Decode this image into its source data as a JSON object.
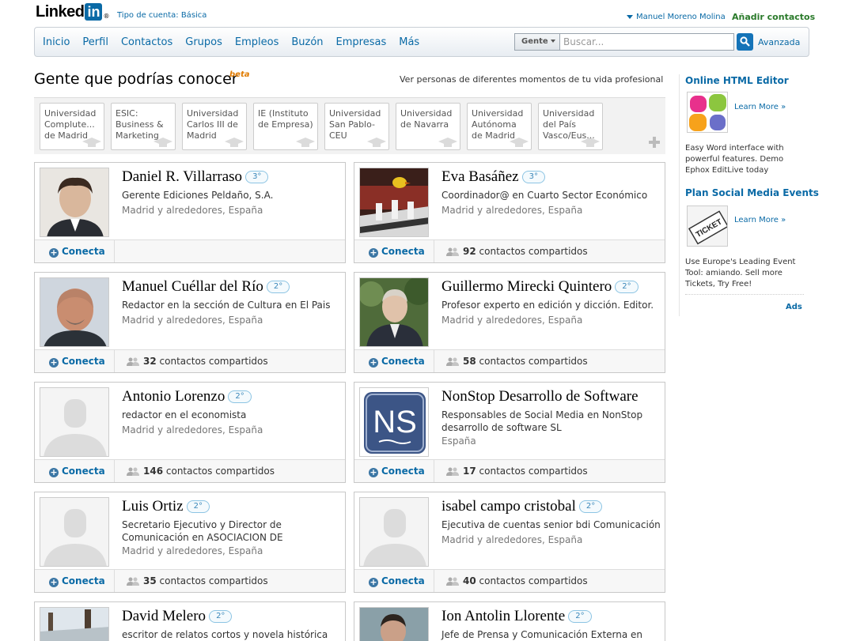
{
  "header": {
    "logo_text": "Linked",
    "logo_box": "in",
    "logo_reg": "®",
    "account_type": "Tipo de cuenta: Básica",
    "user_name": "Manuel Moreno Molina",
    "add_contacts": "Añadir contactos"
  },
  "nav": {
    "items": [
      "Inicio",
      "Perfil",
      "Contactos",
      "Grupos",
      "Empleos",
      "Buzón",
      "Empresas",
      "Más"
    ],
    "search_scope": "Gente",
    "search_placeholder": "Buscar...",
    "advanced": "Avanzada"
  },
  "page": {
    "title": "Gente que podrías conocer",
    "beta": "beta",
    "see_more": "Ver personas de diferentes momentos de tu vida profesional"
  },
  "filters": [
    "Universidad Complute... de Madrid",
    "ESIC: Business & Marketing",
    "Universidad Carlos III de Madrid",
    "IE (Instituto de Empresa)",
    "Universidad San Pablo-CEU",
    "Universidad de Navarra",
    "Universidad Autónoma de Madrid",
    "Universidad del País Vasco/Eus..."
  ],
  "connect_label": "Conecta",
  "shared_suffix": "contactos compartidos",
  "people": [
    {
      "name": "Daniel R. Villarraso",
      "degree": "3°",
      "title": "Gerente Ediciones Peldaño, S.A.",
      "location": "Madrid y alrededores, España",
      "shared": ""
    },
    {
      "name": "Eva Basáñez",
      "degree": "3°",
      "title": "Coordinador@ en Cuarto Sector Económico",
      "location": "Madrid y alrededores, España",
      "shared": "92"
    },
    {
      "name": "Manuel Cuéllar del Río",
      "degree": "2°",
      "title": "Redactor en la sección de Cultura en El Pais",
      "location": "Madrid y alrededores, España",
      "shared": "32"
    },
    {
      "name": "Guillermo Mirecki Quintero",
      "degree": "2°",
      "title": "Profesor experto en edición y dicción. Editor.",
      "location": "Madrid y alrededores, España",
      "shared": "58"
    },
    {
      "name": "Antonio Lorenzo",
      "degree": "2°",
      "title": "redactor en el economista",
      "location": "Madrid y alrededores, España",
      "shared": "146"
    },
    {
      "name": "NonStop Desarrollo de Software",
      "degree": "",
      "title": "Responsables de Social Media en NonStop desarrollo de software SL",
      "location": "España",
      "shared": "17",
      "photo_text": "NS"
    },
    {
      "name": "Luis Ortiz",
      "degree": "2°",
      "title": "Secretario Ejecutivo y Director de Comunicación en ASOCIACION DE",
      "location": "Madrid y alrededores, España",
      "shared": "35"
    },
    {
      "name": "isabel campo cristobal",
      "degree": "2°",
      "title": "Ejecutiva de cuentas senior bdi Comunicación",
      "location": "Madrid y alrededores, España",
      "shared": "40"
    },
    {
      "name": "David Melero",
      "degree": "2°",
      "title": "escritor de relatos cortos y novela histórica",
      "location": "",
      "shared": ""
    },
    {
      "name": "Ion Antolin Llorente",
      "degree": "2°",
      "title": "Jefe de Prensa y Comunicación Externa en",
      "location": "",
      "shared": ""
    }
  ],
  "sidebar": {
    "ad1_title": "Online HTML Editor",
    "ad1_learn": "Learn More »",
    "ad1_desc": "Easy Word interface with powerful features. Demo Ephox EditLive today",
    "ad2_title": "Plan Social Media Events",
    "ad2_learn": "Learn More »",
    "ad2_img_text": "TICKET",
    "ad2_desc": "Use Europe's Leading Event Tool: amiando. Sell more Tickets, Try Free!",
    "ads_label": "Ads"
  },
  "colors": {
    "brand_blue": "#0a6aa6",
    "add_green": "#2a7a2a",
    "beta_orange": "#e07b00"
  }
}
